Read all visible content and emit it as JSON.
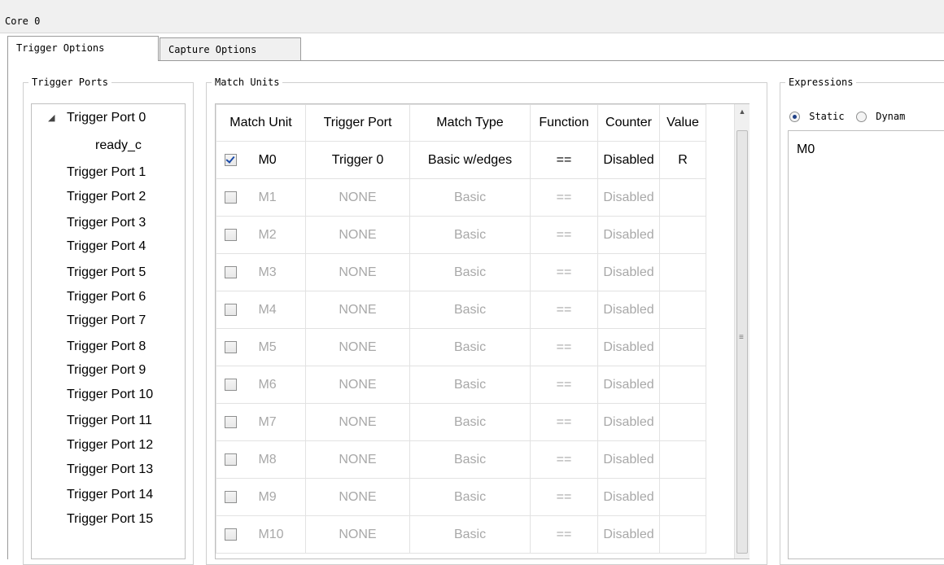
{
  "core": {
    "title": "Core 0"
  },
  "tabs": [
    {
      "label": "Trigger Options",
      "active": true
    },
    {
      "label": "Capture Options",
      "active": false
    }
  ],
  "trigger_ports": {
    "legend": "Trigger Ports",
    "items": [
      {
        "label": "Trigger Port 0",
        "expanded": true
      },
      {
        "label": "ready_c",
        "child": true
      },
      {
        "label": "Trigger Port 1"
      },
      {
        "label": "Trigger Port 2"
      },
      {
        "label": "Trigger Port 3"
      },
      {
        "label": "Trigger Port 4"
      },
      {
        "label": "Trigger Port 5"
      },
      {
        "label": "Trigger Port 6"
      },
      {
        "label": "Trigger Port 7"
      },
      {
        "label": "Trigger Port 8"
      },
      {
        "label": "Trigger Port 9"
      },
      {
        "label": "Trigger Port 10"
      },
      {
        "label": "Trigger Port 11"
      },
      {
        "label": "Trigger Port 12"
      },
      {
        "label": "Trigger Port 13"
      },
      {
        "label": "Trigger Port 14"
      },
      {
        "label": "Trigger Port 15"
      }
    ]
  },
  "match_units": {
    "legend": "Match Units",
    "columns": [
      "Match Unit",
      "Trigger Port",
      "Match Type",
      "Function",
      "Counter",
      "Value"
    ],
    "rows": [
      {
        "checked": true,
        "unit": "M0",
        "port": "Trigger 0",
        "type": "Basic w/edges",
        "function": "==",
        "counter": "Disabled",
        "value": "R"
      },
      {
        "checked": false,
        "unit": "M1",
        "port": "NONE",
        "type": "Basic",
        "function": "==",
        "counter": "Disabled",
        "value": ""
      },
      {
        "checked": false,
        "unit": "M2",
        "port": "NONE",
        "type": "Basic",
        "function": "==",
        "counter": "Disabled",
        "value": ""
      },
      {
        "checked": false,
        "unit": "M3",
        "port": "NONE",
        "type": "Basic",
        "function": "==",
        "counter": "Disabled",
        "value": ""
      },
      {
        "checked": false,
        "unit": "M4",
        "port": "NONE",
        "type": "Basic",
        "function": "==",
        "counter": "Disabled",
        "value": ""
      },
      {
        "checked": false,
        "unit": "M5",
        "port": "NONE",
        "type": "Basic",
        "function": "==",
        "counter": "Disabled",
        "value": ""
      },
      {
        "checked": false,
        "unit": "M6",
        "port": "NONE",
        "type": "Basic",
        "function": "==",
        "counter": "Disabled",
        "value": ""
      },
      {
        "checked": false,
        "unit": "M7",
        "port": "NONE",
        "type": "Basic",
        "function": "==",
        "counter": "Disabled",
        "value": ""
      },
      {
        "checked": false,
        "unit": "M8",
        "port": "NONE",
        "type": "Basic",
        "function": "==",
        "counter": "Disabled",
        "value": ""
      },
      {
        "checked": false,
        "unit": "M9",
        "port": "NONE",
        "type": "Basic",
        "function": "==",
        "counter": "Disabled",
        "value": ""
      },
      {
        "checked": false,
        "unit": "M10",
        "port": "NONE",
        "type": "Basic",
        "function": "==",
        "counter": "Disabled",
        "value": ""
      }
    ]
  },
  "expressions": {
    "legend": "Expressions",
    "static_label": "Static",
    "dynamic_label": "Dynam",
    "selected": "static",
    "text": "M0"
  }
}
